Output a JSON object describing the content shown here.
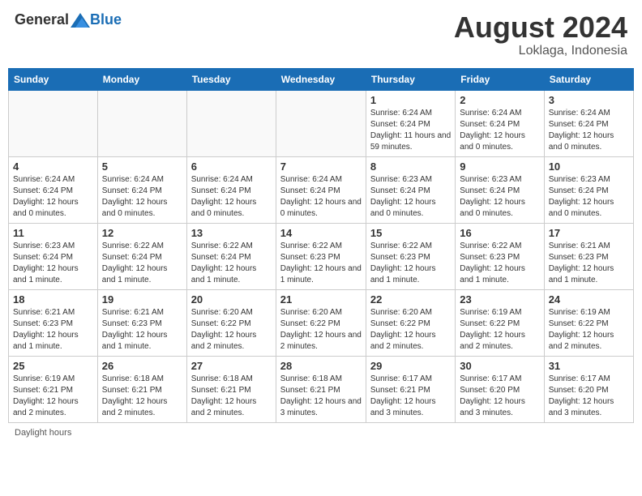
{
  "header": {
    "logo_general": "General",
    "logo_blue": "Blue",
    "month_year": "August 2024",
    "location": "Loklaga, Indonesia"
  },
  "days_of_week": [
    "Sunday",
    "Monday",
    "Tuesday",
    "Wednesday",
    "Thursday",
    "Friday",
    "Saturday"
  ],
  "weeks": [
    [
      {
        "day": "",
        "info": ""
      },
      {
        "day": "",
        "info": ""
      },
      {
        "day": "",
        "info": ""
      },
      {
        "day": "",
        "info": ""
      },
      {
        "day": "1",
        "info": "Sunrise: 6:24 AM\nSunset: 6:24 PM\nDaylight: 11 hours and 59 minutes."
      },
      {
        "day": "2",
        "info": "Sunrise: 6:24 AM\nSunset: 6:24 PM\nDaylight: 12 hours and 0 minutes."
      },
      {
        "day": "3",
        "info": "Sunrise: 6:24 AM\nSunset: 6:24 PM\nDaylight: 12 hours and 0 minutes."
      }
    ],
    [
      {
        "day": "4",
        "info": "Sunrise: 6:24 AM\nSunset: 6:24 PM\nDaylight: 12 hours and 0 minutes."
      },
      {
        "day": "5",
        "info": "Sunrise: 6:24 AM\nSunset: 6:24 PM\nDaylight: 12 hours and 0 minutes."
      },
      {
        "day": "6",
        "info": "Sunrise: 6:24 AM\nSunset: 6:24 PM\nDaylight: 12 hours and 0 minutes."
      },
      {
        "day": "7",
        "info": "Sunrise: 6:24 AM\nSunset: 6:24 PM\nDaylight: 12 hours and 0 minutes."
      },
      {
        "day": "8",
        "info": "Sunrise: 6:23 AM\nSunset: 6:24 PM\nDaylight: 12 hours and 0 minutes."
      },
      {
        "day": "9",
        "info": "Sunrise: 6:23 AM\nSunset: 6:24 PM\nDaylight: 12 hours and 0 minutes."
      },
      {
        "day": "10",
        "info": "Sunrise: 6:23 AM\nSunset: 6:24 PM\nDaylight: 12 hours and 0 minutes."
      }
    ],
    [
      {
        "day": "11",
        "info": "Sunrise: 6:23 AM\nSunset: 6:24 PM\nDaylight: 12 hours and 1 minute."
      },
      {
        "day": "12",
        "info": "Sunrise: 6:22 AM\nSunset: 6:24 PM\nDaylight: 12 hours and 1 minute."
      },
      {
        "day": "13",
        "info": "Sunrise: 6:22 AM\nSunset: 6:24 PM\nDaylight: 12 hours and 1 minute."
      },
      {
        "day": "14",
        "info": "Sunrise: 6:22 AM\nSunset: 6:23 PM\nDaylight: 12 hours and 1 minute."
      },
      {
        "day": "15",
        "info": "Sunrise: 6:22 AM\nSunset: 6:23 PM\nDaylight: 12 hours and 1 minute."
      },
      {
        "day": "16",
        "info": "Sunrise: 6:22 AM\nSunset: 6:23 PM\nDaylight: 12 hours and 1 minute."
      },
      {
        "day": "17",
        "info": "Sunrise: 6:21 AM\nSunset: 6:23 PM\nDaylight: 12 hours and 1 minute."
      }
    ],
    [
      {
        "day": "18",
        "info": "Sunrise: 6:21 AM\nSunset: 6:23 PM\nDaylight: 12 hours and 1 minute."
      },
      {
        "day": "19",
        "info": "Sunrise: 6:21 AM\nSunset: 6:23 PM\nDaylight: 12 hours and 1 minute."
      },
      {
        "day": "20",
        "info": "Sunrise: 6:20 AM\nSunset: 6:22 PM\nDaylight: 12 hours and 2 minutes."
      },
      {
        "day": "21",
        "info": "Sunrise: 6:20 AM\nSunset: 6:22 PM\nDaylight: 12 hours and 2 minutes."
      },
      {
        "day": "22",
        "info": "Sunrise: 6:20 AM\nSunset: 6:22 PM\nDaylight: 12 hours and 2 minutes."
      },
      {
        "day": "23",
        "info": "Sunrise: 6:19 AM\nSunset: 6:22 PM\nDaylight: 12 hours and 2 minutes."
      },
      {
        "day": "24",
        "info": "Sunrise: 6:19 AM\nSunset: 6:22 PM\nDaylight: 12 hours and 2 minutes."
      }
    ],
    [
      {
        "day": "25",
        "info": "Sunrise: 6:19 AM\nSunset: 6:21 PM\nDaylight: 12 hours and 2 minutes."
      },
      {
        "day": "26",
        "info": "Sunrise: 6:18 AM\nSunset: 6:21 PM\nDaylight: 12 hours and 2 minutes."
      },
      {
        "day": "27",
        "info": "Sunrise: 6:18 AM\nSunset: 6:21 PM\nDaylight: 12 hours and 2 minutes."
      },
      {
        "day": "28",
        "info": "Sunrise: 6:18 AM\nSunset: 6:21 PM\nDaylight: 12 hours and 3 minutes."
      },
      {
        "day": "29",
        "info": "Sunrise: 6:17 AM\nSunset: 6:21 PM\nDaylight: 12 hours and 3 minutes."
      },
      {
        "day": "30",
        "info": "Sunrise: 6:17 AM\nSunset: 6:20 PM\nDaylight: 12 hours and 3 minutes."
      },
      {
        "day": "31",
        "info": "Sunrise: 6:17 AM\nSunset: 6:20 PM\nDaylight: 12 hours and 3 minutes."
      }
    ]
  ],
  "footer": {
    "daylight_hours": "Daylight hours"
  }
}
